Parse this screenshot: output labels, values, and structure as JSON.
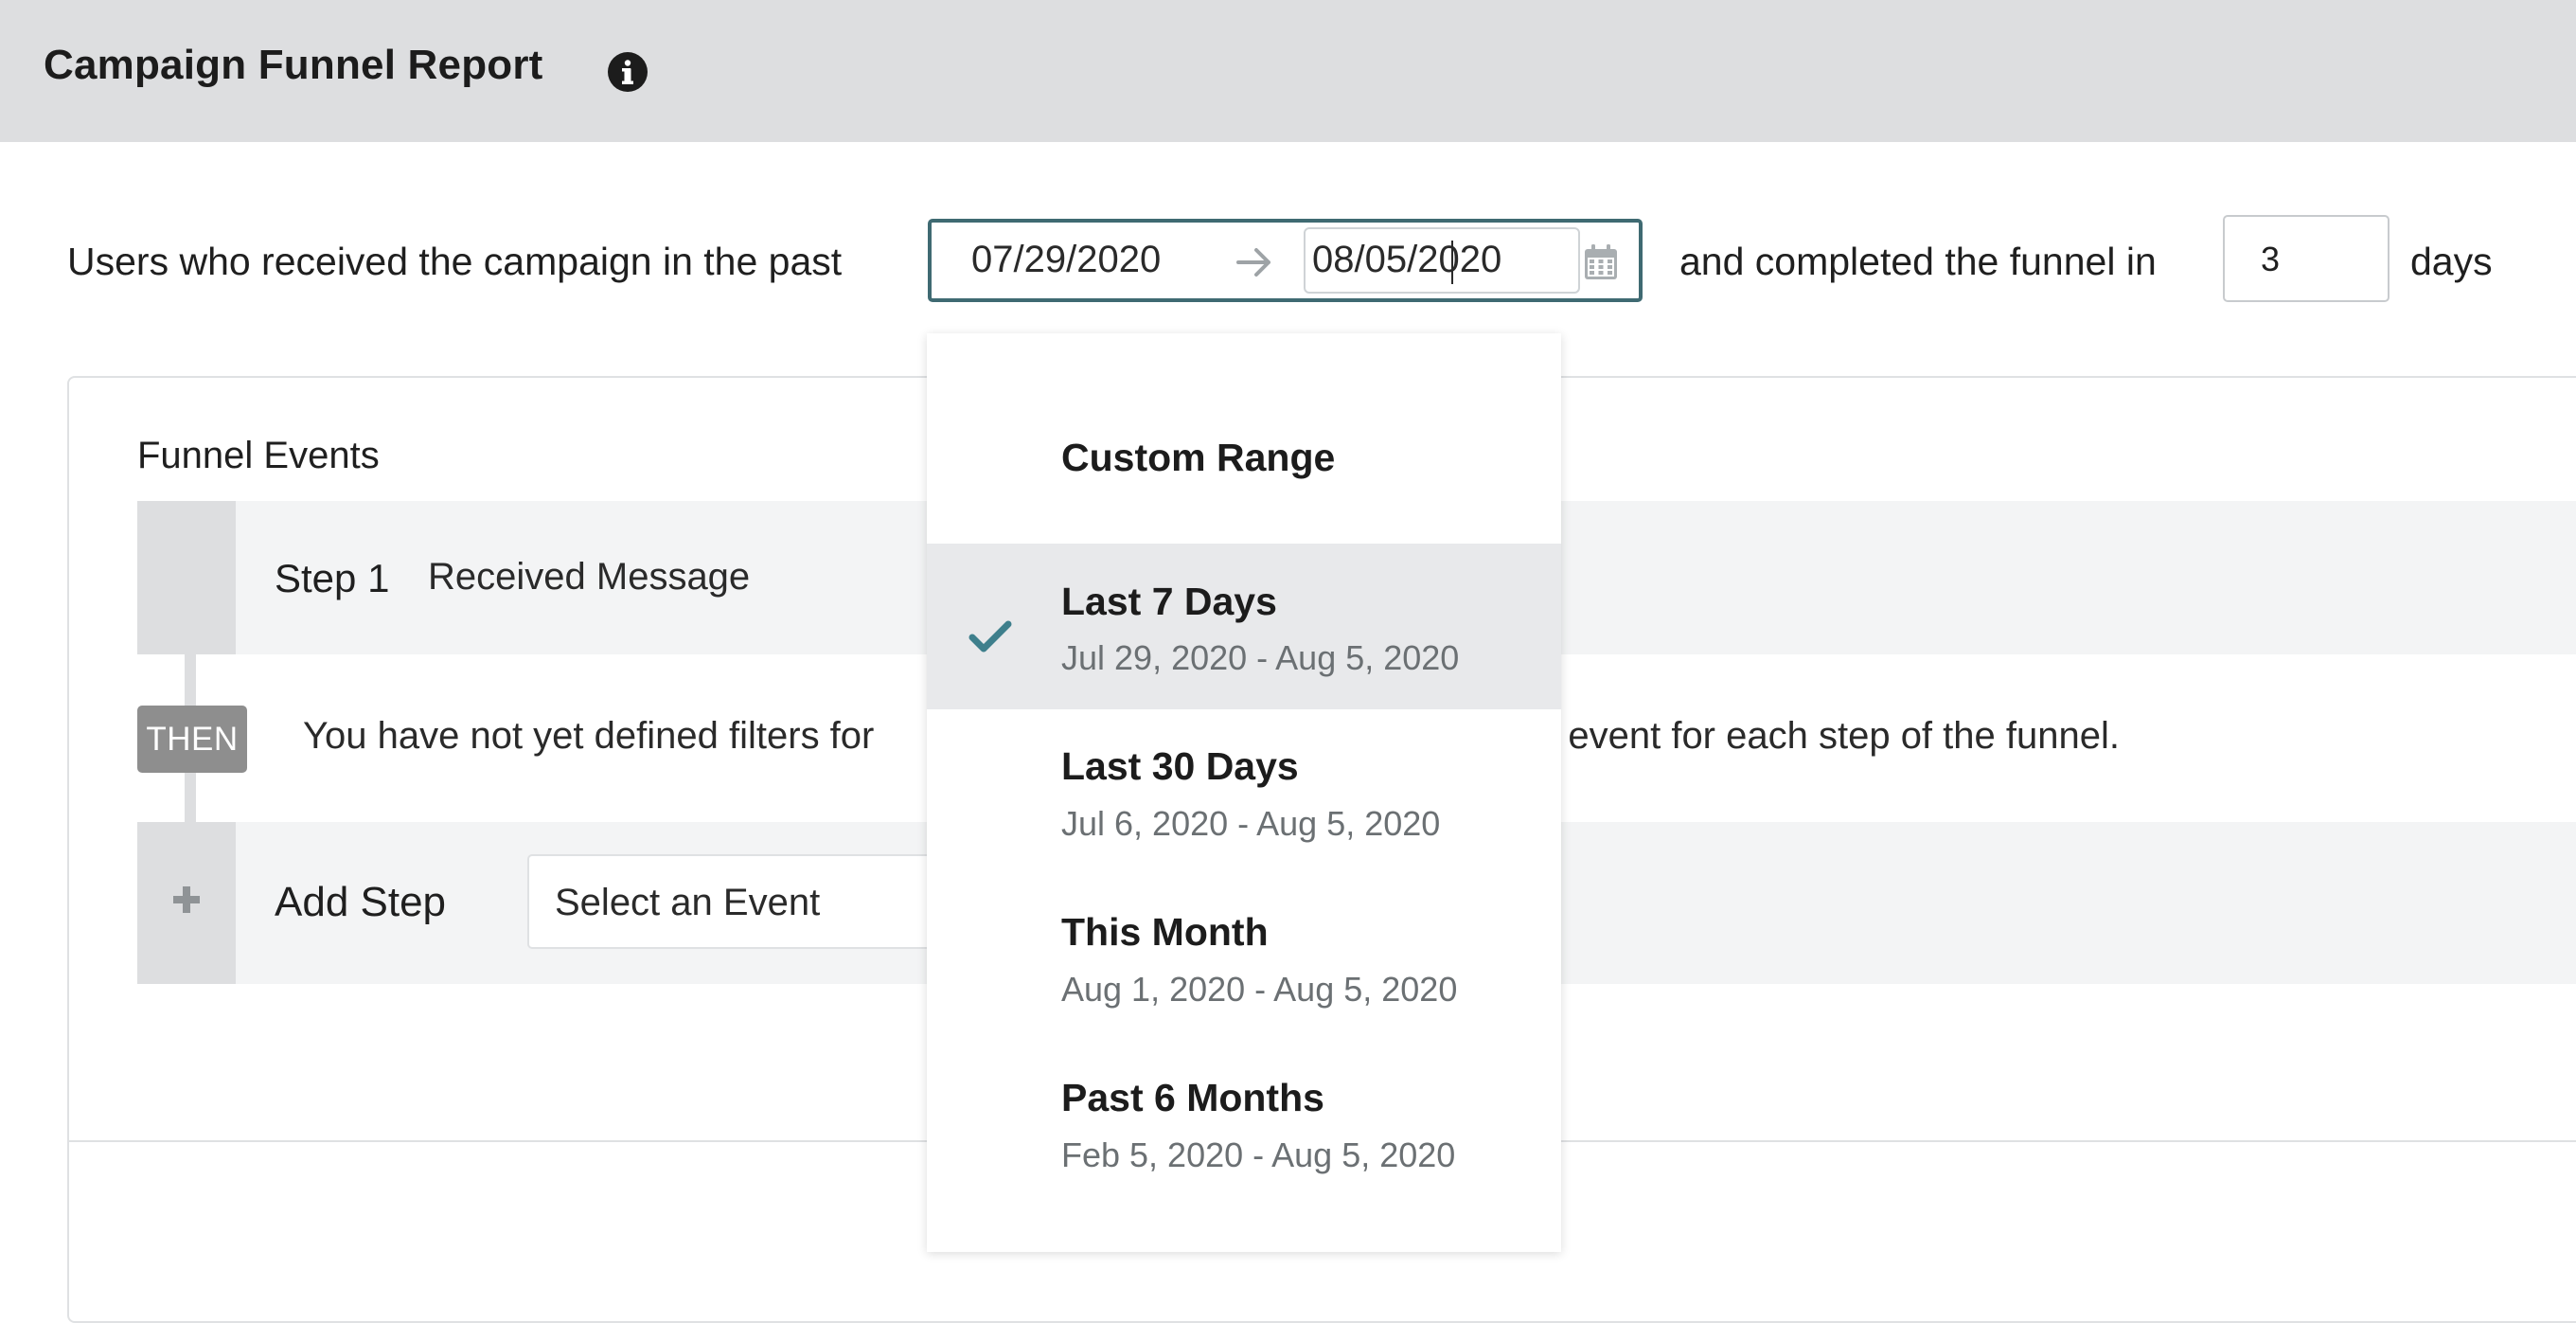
{
  "header": {
    "title": "Campaign Funnel Report",
    "info_icon": "info-circle-icon"
  },
  "filter": {
    "prefix": "Users who received the campaign in the past",
    "start_date": "07/29/2020",
    "end_date": "08/05/2020",
    "arrow_icon": "arrow-right-icon",
    "calendar_icon": "calendar-icon",
    "middle": "and completed the funnel in",
    "days_value": "3",
    "suffix": "days"
  },
  "funnel": {
    "label": "Funnel Events",
    "step1": {
      "number": "Step 1",
      "name": "Received Message"
    },
    "then_badge": "THEN",
    "then_message_left": "You have not yet defined filters for",
    "then_message_right": "n event for each step of the funnel.",
    "add_step": {
      "label": "Add Step",
      "icon": "plus-icon",
      "select_placeholder": "Select an Event"
    }
  },
  "dropdown": {
    "options": [
      {
        "title": "Custom Range",
        "range": "",
        "selected": false
      },
      {
        "title": "Last 7 Days",
        "range": "Jul 29, 2020 - Aug 5, 2020",
        "selected": true
      },
      {
        "title": "Last 30 Days",
        "range": "Jul 6, 2020 - Aug 5, 2020",
        "selected": false
      },
      {
        "title": "This Month",
        "range": "Aug 1, 2020 - Aug 5, 2020",
        "selected": false
      },
      {
        "title": "Past 6 Months",
        "range": "Feb 5, 2020 - Aug 5, 2020",
        "selected": false
      }
    ],
    "check_icon": "checkmark-icon"
  },
  "colors": {
    "header_bg": "#dddee0",
    "accent": "#3f6a72",
    "check": "#3e7f8c",
    "selected_bg": "#e8e9eb",
    "then_badge": "#8e8e8e"
  }
}
